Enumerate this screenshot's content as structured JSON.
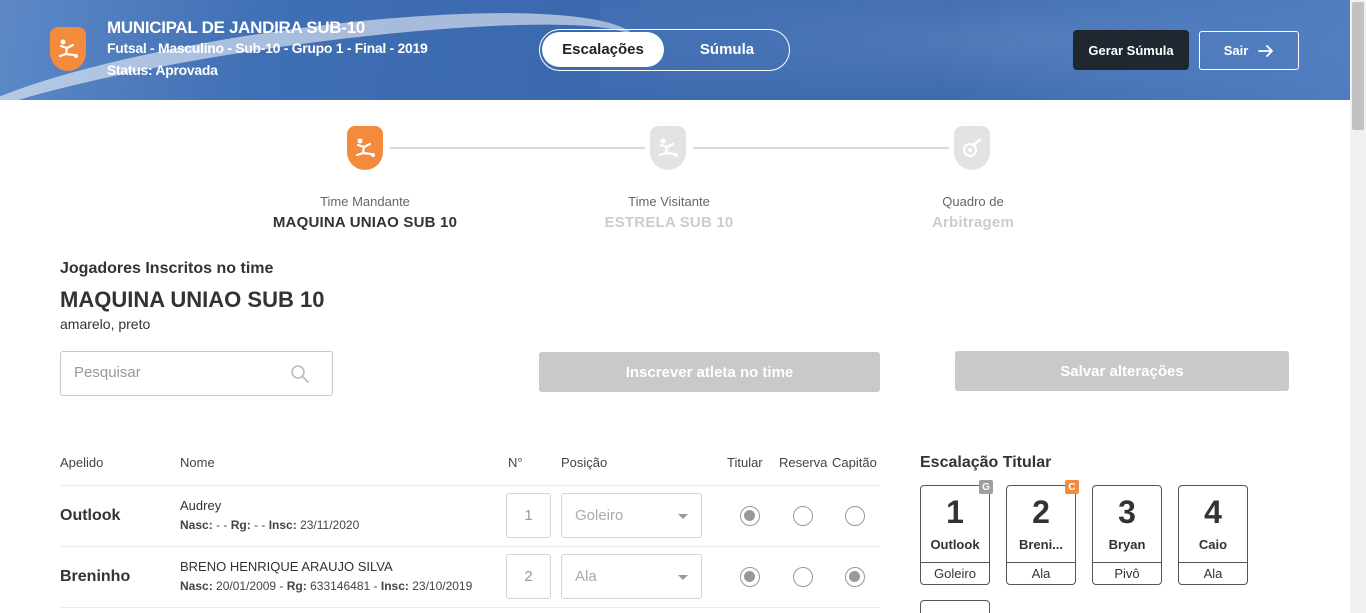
{
  "header": {
    "title": "MUNICIPAL DE JANDIRA SUB-10",
    "subtitle": "Futsal - Masculino - Sub-10 - Grupo 1 - Final - 2019",
    "status": "Status: Aprovada",
    "tabs": [
      {
        "label": "Escalações",
        "active": true
      },
      {
        "label": "Súmula",
        "active": false
      }
    ],
    "gerar_label": "Gerar Súmula",
    "sair_label": "Sair",
    "accent": "#f28b3b"
  },
  "stepper": [
    {
      "label": "Time Mandante",
      "value": "MAQUINA UNIAO SUB 10",
      "active": true
    },
    {
      "label": "Time Visitante",
      "value": "ESTRELA SUB 10",
      "active": false
    },
    {
      "label": "Quadro de",
      "value": "Arbitragem",
      "active": false
    }
  ],
  "section": {
    "title": "Jogadores Inscritos no time",
    "team_name": "MAQUINA UNIAO SUB 10",
    "team_colors": "amarelo, preto"
  },
  "search": {
    "placeholder": "Pesquisar",
    "value": ""
  },
  "actions": {
    "inscrever_label": "Inscrever atleta no time",
    "salvar_label": "Salvar alterações"
  },
  "table": {
    "headers": [
      "Apelido",
      "Nome",
      "N°",
      "Posição",
      "Titular",
      "Reserva",
      "Capitão"
    ],
    "rows": [
      {
        "apelido": "Outlook",
        "nome": "Audrey",
        "nasc_label": "Nasc:",
        "nasc": "-",
        "rg_label": "Rg:",
        "rg": "-",
        "insc_label": "Insc:",
        "insc": "23/11/2020",
        "numero": "1",
        "posicao": "Goleiro",
        "titular": true,
        "reserva": false,
        "capitao": false
      },
      {
        "apelido": "Breninho",
        "nome": "BRENO HENRIQUE ARAUJO SILVA",
        "nasc_label": "Nasc:",
        "nasc": "20/01/2009",
        "rg_label": "Rg:",
        "rg": "633146481",
        "insc_label": "Insc:",
        "insc": "23/10/2019",
        "numero": "2",
        "posicao": "Ala",
        "titular": true,
        "reserva": false,
        "capitao": true
      }
    ]
  },
  "escalacao": {
    "title": "Escalação Titular",
    "cards": [
      {
        "numero": "1",
        "nome": "Outlook",
        "posicao": "Goleiro",
        "badge": "G",
        "badge_color": "#9e9e9e"
      },
      {
        "numero": "2",
        "nome": "Breni...",
        "posicao": "Ala",
        "badge": "C",
        "badge_color": "#f28b3b"
      },
      {
        "numero": "3",
        "nome": "Bryan",
        "posicao": "Pivô",
        "badge": "",
        "badge_color": ""
      },
      {
        "numero": "4",
        "nome": "Caio",
        "posicao": "Ala",
        "badge": "",
        "badge_color": ""
      }
    ]
  }
}
